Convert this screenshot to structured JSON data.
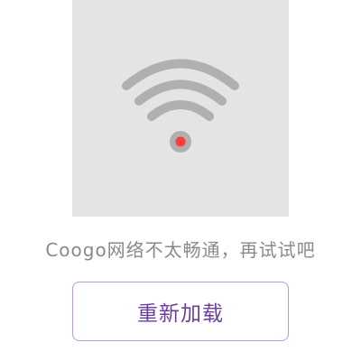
{
  "illustration": {
    "icon": "wifi-icon",
    "status_dot": "red-dot",
    "background_color": "#e4e4e4",
    "arc_color": "#b0b0b0",
    "dot_color": "#ff3b3b"
  },
  "message": "Coogo网络不太畅通，再试试吧",
  "reload_button": {
    "label": "重新加载",
    "text_color": "#6b3fa0",
    "border_color": "#b59ad6"
  }
}
